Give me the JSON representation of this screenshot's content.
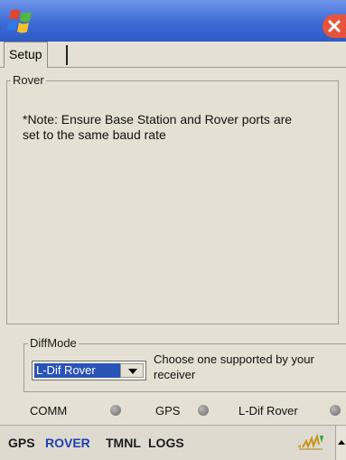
{
  "tabs": [
    {
      "label": "Setup",
      "selected": true
    }
  ],
  "rover_group": {
    "title": "Rover",
    "note": "*Note: Ensure Base Station and Rover ports are set to the same baud rate"
  },
  "diffmode": {
    "title": "DiffMode",
    "selected": "L-Dif Rover",
    "hint": "Choose one supported by your receiver"
  },
  "status": [
    {
      "label": "COMM",
      "led": "gray"
    },
    {
      "label": "GPS",
      "led": "gray"
    },
    {
      "label": "L-Dif Rover",
      "led": "gray"
    }
  ],
  "taskbar": {
    "items": [
      {
        "label": "GPS",
        "active": false
      },
      {
        "label": "ROVER",
        "active": true
      },
      {
        "label": "TMNL",
        "active": false
      },
      {
        "label": "LOGS",
        "active": false
      }
    ],
    "signal_icon": "signal-strength-icon",
    "scroll_icon": "scroll-up-icon"
  },
  "titlebar": {
    "start_icon": "windows-flag-icon",
    "close_icon": "close-icon"
  },
  "colors": {
    "titlebar": "#3d6bd6",
    "close": "#e8543b",
    "selection": "#2a53b8",
    "active_task": "#1f3fae",
    "background": "#e4e0d3"
  }
}
